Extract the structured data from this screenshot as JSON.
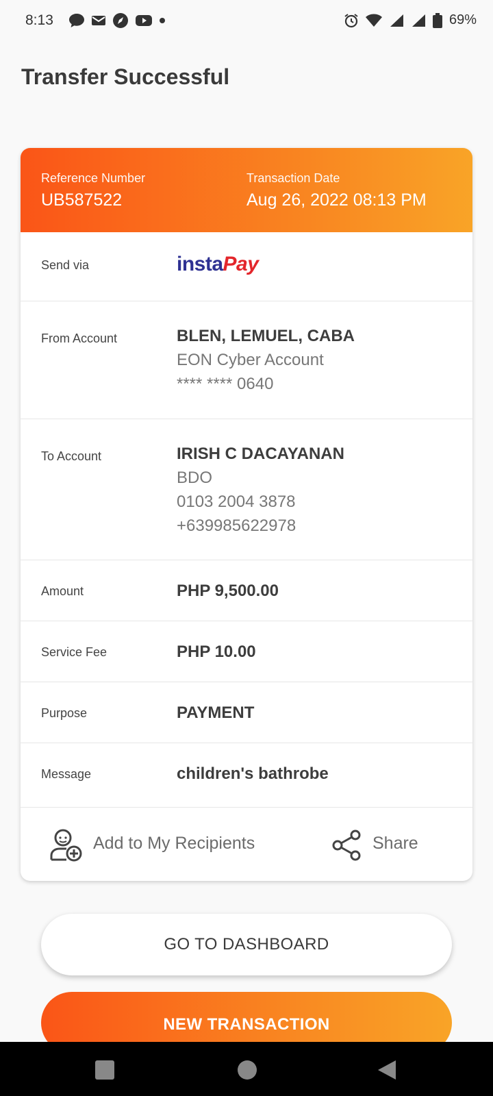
{
  "status": {
    "time": "8:13",
    "battery": "69%",
    "left_icons": [
      "chat-icon",
      "mail-icon",
      "compass-icon",
      "youtube-icon",
      "dot-icon"
    ],
    "right_icons": [
      "alarm-icon",
      "wifi-icon",
      "signal-icon",
      "signal-icon",
      "battery-icon"
    ]
  },
  "title": "Transfer Successful",
  "header": {
    "ref_label": "Reference Number",
    "ref_value": "UB587522",
    "date_label": "Transaction Date",
    "date_value": "Aug 26, 2022 08:13 PM",
    "gradient": [
      "#fa5517",
      "#f9a427"
    ]
  },
  "send_via": {
    "label": "Send via",
    "logo_insta": "insta",
    "logo_pay": "Pay"
  },
  "from": {
    "label": "From Account",
    "name": "BLEN, LEMUEL, CABA",
    "account_type": "EON Cyber Account",
    "account_number": "**** **** 0640"
  },
  "to": {
    "label": "To Account",
    "name": "IRISH C DACAYANAN",
    "bank": "BDO",
    "account_number": "0103 2004 3878",
    "phone": "+639985622978"
  },
  "amount": {
    "label": "Amount",
    "value": "PHP 9,500.00"
  },
  "fee": {
    "label": "Service Fee",
    "value": "PHP 10.00"
  },
  "purpose": {
    "label": "Purpose",
    "value": "PAYMENT"
  },
  "message": {
    "label": "Message",
    "value": "children's bathrobe"
  },
  "actions": {
    "add_recipient": "Add to My Recipients",
    "share": "Share"
  },
  "buttons": {
    "dashboard": "GO TO DASHBOARD",
    "new_transaction": "NEW TRANSACTION"
  },
  "nav": [
    "recents-icon",
    "home-icon",
    "back-icon"
  ]
}
